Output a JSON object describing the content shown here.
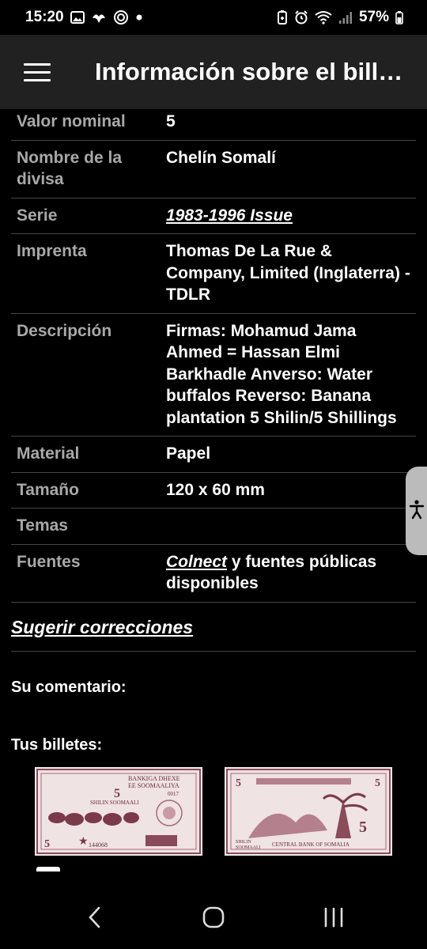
{
  "status_bar": {
    "time": "15:20",
    "battery": "57%",
    "left_icons": [
      "gallery-icon",
      "bird-icon",
      "signal-app-icon",
      "dot-icon"
    ],
    "right_icons": [
      "battery-saver-icon",
      "alarm-icon",
      "wifi-icon",
      "signal-icon",
      "battery-icon"
    ]
  },
  "app_bar": {
    "title": "Información sobre el bill…",
    "menu_icon": "hamburger-menu-icon"
  },
  "details": [
    {
      "key": "Valor nominal",
      "value": "5"
    },
    {
      "key": "Nombre de la divisa",
      "value": "Chelín Somalí"
    },
    {
      "key": "Serie",
      "value": "1983-1996 Issue"
    },
    {
      "key": "Imprenta",
      "value": "Thomas De La Rue & Company, Limited (Inglaterra) - TDLR"
    },
    {
      "key": "Descripción",
      "value": "Firmas: Mohamud Jama Ahmed = Hassan Elmi Barkhadle Anverso: Water buffalos Reverso: Banana plantation 5 Shilin/5 Shillings"
    },
    {
      "key": "Material",
      "value": "Papel"
    },
    {
      "key": "Tamaño",
      "value": "120 x 60 mm"
    },
    {
      "key": "Temas",
      "value": ""
    },
    {
      "key": "Fuentes",
      "link": "Colnect",
      "value": " y fuentes públicas disponibles"
    }
  ],
  "suggest_link": "Sugerir correcciones",
  "comment_label": "Su comentario:",
  "notes_label": "Tus billetes:",
  "banknote_front": {
    "lines": [
      "BANKIGA DHEXE",
      "EE SOOMAALIYA",
      "SHILIN SOOMAALI",
      "0017",
      "144068"
    ],
    "denomination": "5"
  },
  "banknote_back": {
    "lines": [
      "SHILIN",
      "SOOMAALI",
      "CENTRAL BANK OF SOMALIA"
    ],
    "denomination": "5"
  },
  "accessibility_tab_icon": "accessibility-icon",
  "nav_bar": {
    "buttons": [
      "back-icon",
      "home-icon",
      "recents-icon"
    ]
  },
  "colors": {
    "background": "#000000",
    "app_bar": "#212121",
    "key_text": "#a8a8a8",
    "divider": "#444444",
    "note_ink": "#7a3a4a"
  }
}
